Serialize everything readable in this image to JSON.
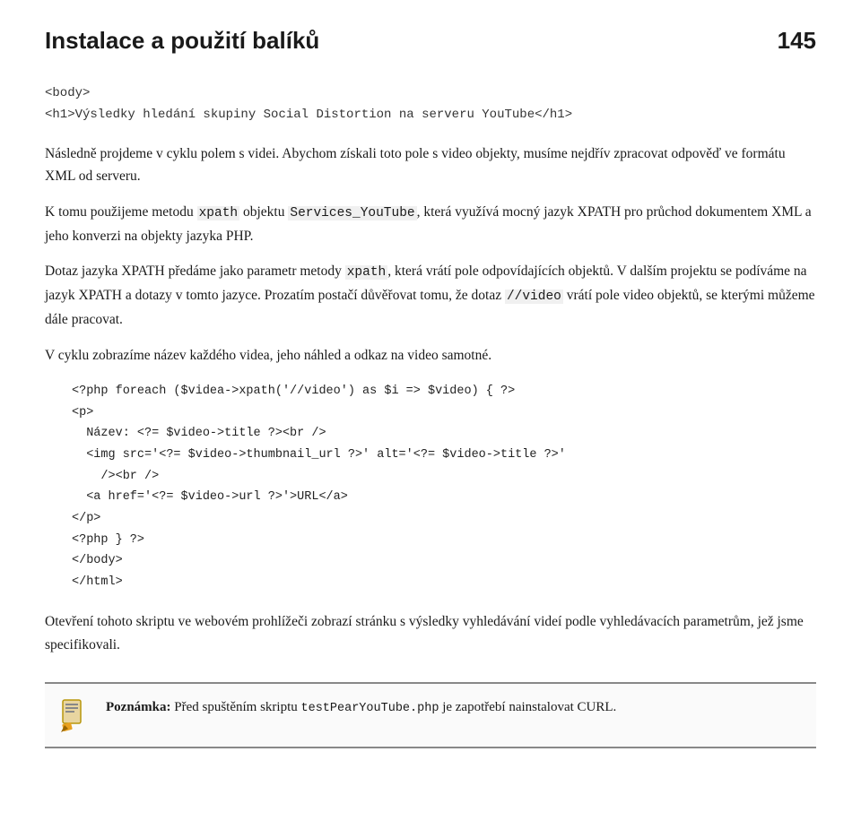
{
  "header": {
    "title": "Instalace a použití balíků",
    "page_number": "145"
  },
  "intro_code": {
    "line1": "<body>",
    "line2": "<h1>Výsledky hledání skupiny Social Distortion na serveru YouTube</h1>"
  },
  "paragraphs": {
    "p1": "Následně projdeme v cyklu polem s videi. Abychom získali toto pole s video objekty, musíme nejdřív zpracovat odpověď ve formátu XML od serveru.",
    "p2_pre": "K tomu použijeme metodu ",
    "p2_code1": "xpath",
    "p2_mid1": " objektu ",
    "p2_code2": "Services_YouTube",
    "p2_mid2": ", která využívá mocný jazyk XPATH pro průchod dokumentem XML a jeho konverzi na objekty jazyka PHP.",
    "p3_pre": "Dotaz jazyka XPATH předáme jako parametr metody ",
    "p3_code": "xpath",
    "p3_post": ", která vrátí pole odpovídajících objektů. V dalším projektu se podíváme na jazyk XPATH a dotazy v tomto jazyce.",
    "p4_pre": "Prozatím postačí důvěřovat tomu, že dotaz ",
    "p4_code": "//video",
    "p4_post": " vrátí pole video objektů, se kterými můžeme dále pracovat.",
    "p5": "V cyklu zobrazíme název každého videa, jeho náhled a odkaz na video samotné."
  },
  "code_block": {
    "lines": [
      "<?php foreach ($videa->xpath('//video') as $i => $video) { ?>",
      "<p>",
      "  Název: <?= $video->title ?><br />",
      "  <img src='<?= $video->thumbnail_url ?>' alt='<?= $video->title ?>'",
      "    /><br />",
      "  <a href='<?= $video->url ?>'>URL</a>",
      "</p>",
      "<?php } ?>",
      "</body>",
      "</html>"
    ]
  },
  "closing_paragraph": "Otevření tohoto skriptu ve webovém prohlížeči zobrazí stránku s výsledky vyhledávání videí podle vyhledávacích parametrům, jež jsme specifikovali.",
  "note": {
    "label": "Poznámka:",
    "pre": "Před spuštěním skriptu ",
    "code": "testPearYouTube.php",
    "post": " je zapotřebí nainstalovat CURL."
  },
  "icons": {
    "note_icon": "✏️"
  }
}
